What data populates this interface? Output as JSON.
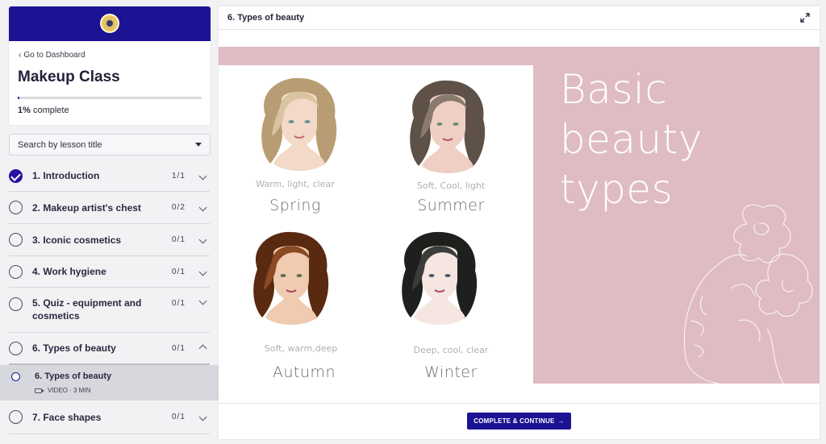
{
  "sidebar": {
    "back_link": "Go to Dashboard",
    "course_title": "Makeup Class",
    "progress": {
      "percent_label": "1%",
      "suffix": "complete",
      "fraction": 0.01
    },
    "search": {
      "placeholder": "Search by lesson title"
    },
    "lessons": [
      {
        "title": "1. Introduction",
        "count": "1/1",
        "done": true
      },
      {
        "title": "2. Makeup artist's chest",
        "count": "0/2"
      },
      {
        "title": "3. Iconic cosmetics",
        "count": "0/1"
      },
      {
        "title": "4. Work hygiene",
        "count": "0/1"
      },
      {
        "title": "5. Quiz - equipment and cosmetics",
        "count": "0/1"
      },
      {
        "title": "6. Types of beauty",
        "count": "0/1",
        "expanded": true
      },
      {
        "title": "7. Face shapes",
        "count": "0/1"
      }
    ],
    "active_sublesson": {
      "title": "6. Types of beauty",
      "meta": "VIDEO · 3 MIN"
    }
  },
  "main": {
    "header_title": "6. Types of beauty",
    "slide": {
      "title_lines": [
        "Basic",
        "beauty",
        "types"
      ],
      "types": [
        {
          "desc": "Warm, light, clear",
          "name": "Spring",
          "hair": "#d9c3a0",
          "hair_dark": "#b89d74",
          "skin": "#f3d9c7"
        },
        {
          "desc": "Soft, Cool, light",
          "name": "Summer",
          "hair": "#8a7a6e",
          "hair_dark": "#5e5148",
          "skin": "#efcfc4"
        },
        {
          "desc": "Soft, warm,deep",
          "name": "Autumn",
          "hair": "#8a4a24",
          "hair_dark": "#5a2a10",
          "skin": "#f0cbb0"
        },
        {
          "desc": "Deep, cool, clear",
          "name": "Winter",
          "hair": "#3a3d3a",
          "hair_dark": "#1e201e",
          "skin": "#f6e6e1"
        }
      ]
    },
    "cta_label": "COMPLETE & CONTINUE",
    "cta_arrow": "→"
  },
  "colors": {
    "brand": "#1c1294",
    "slide_pink": "#dfbcc4"
  }
}
